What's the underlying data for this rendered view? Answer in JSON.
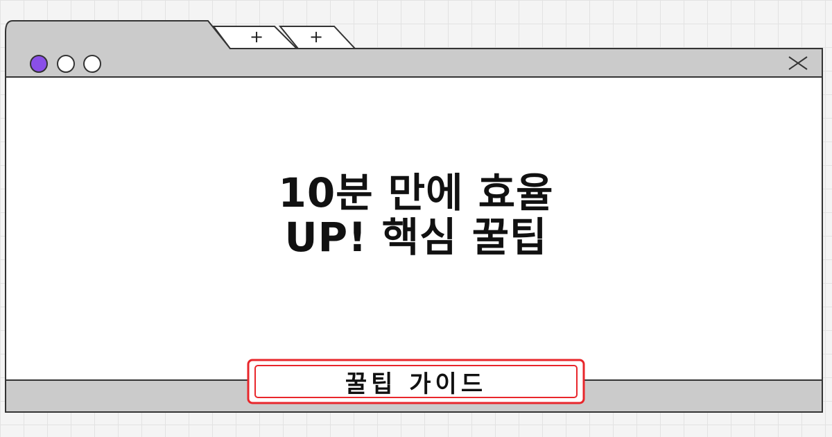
{
  "window": {
    "tabs": [
      {
        "label": "+",
        "icon": "plus-icon"
      },
      {
        "label": "+",
        "icon": "plus-icon"
      }
    ],
    "controls": [
      "traffic-light-purple",
      "traffic-light-white",
      "traffic-light-white"
    ],
    "close_icon": "close-icon"
  },
  "content": {
    "title_line1": "10분 만에 효율",
    "title_line2": "UP! 핵심 꿀팁"
  },
  "badge": {
    "label": "꿀팁 가이드",
    "border_color": "#e8262b"
  },
  "colors": {
    "chrome": "#cbcbcb",
    "accent": "#8a4fe8",
    "outline": "#333333",
    "background": "#ffffff"
  }
}
